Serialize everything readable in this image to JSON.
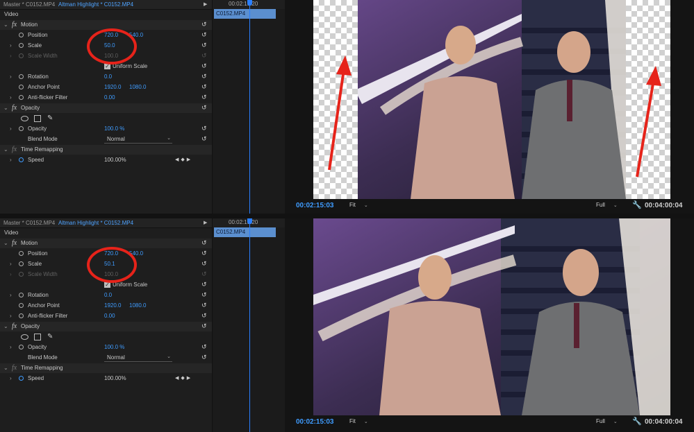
{
  "accent": "#3f9cff",
  "annotation_color": "#e6231a",
  "panels": [
    {
      "tabs": {
        "master": "Master * C0152.MP4",
        "sequence": "Altman Highlight * C0152.MP4"
      },
      "section_video": "Video",
      "motion": {
        "label": "Motion",
        "position": {
          "label": "Position",
          "x": "720.0",
          "y": "540.0"
        },
        "scale": {
          "label": "Scale",
          "value": "50.0"
        },
        "scale_width": {
          "label": "Scale Width",
          "value": "100.0"
        },
        "uniform_scale": {
          "label": "Uniform Scale",
          "checked": true
        },
        "rotation": {
          "label": "Rotation",
          "value": "0.0"
        },
        "anchor_point": {
          "label": "Anchor Point",
          "x": "1920.0",
          "y": "1080.0"
        },
        "anti_flicker": {
          "label": "Anti-flicker Filter",
          "value": "0.00"
        }
      },
      "opacity": {
        "label": "Opacity",
        "value_label": "Opacity",
        "value": "100.0 %",
        "blend_label": "Blend Mode",
        "blend_value": "Normal"
      },
      "time_remapping": {
        "label": "Time Remapping",
        "speed_label": "Speed",
        "speed_value": "100.00%"
      },
      "timeline": {
        "time": "00:02:15:20",
        "clip": "C0152.MP4"
      },
      "program": {
        "timecode": "00:02:15:03",
        "fit": "Fit",
        "quality": "Full",
        "duration": "00:04:00:04",
        "transparent_bars": true,
        "arrows": true
      }
    },
    {
      "tabs": {
        "master": "Master * C0152.MP4",
        "sequence": "Altman Highlight * C0152.MP4"
      },
      "section_video": "Video",
      "motion": {
        "label": "Motion",
        "position": {
          "label": "Position",
          "x": "720.0",
          "y": "540.0"
        },
        "scale": {
          "label": "Scale",
          "value": "50.1"
        },
        "scale_width": {
          "label": "Scale Width",
          "value": "100.0"
        },
        "uniform_scale": {
          "label": "Uniform Scale",
          "checked": true
        },
        "rotation": {
          "label": "Rotation",
          "value": "0.0"
        },
        "anchor_point": {
          "label": "Anchor Point",
          "x": "1920.0",
          "y": "1080.0"
        },
        "anti_flicker": {
          "label": "Anti-flicker Filter",
          "value": "0.00"
        }
      },
      "opacity": {
        "label": "Opacity",
        "value_label": "Opacity",
        "value": "100.0 %",
        "blend_label": "Blend Mode",
        "blend_value": "Normal"
      },
      "time_remapping": {
        "label": "Time Remapping",
        "speed_label": "Speed",
        "speed_value": "100.00%"
      },
      "timeline": {
        "time": "00:02:15:20",
        "clip": "C0152.MP4"
      },
      "program": {
        "timecode": "00:02:15:03",
        "fit": "Fit",
        "quality": "Full",
        "duration": "00:04:00:04",
        "transparent_bars": false,
        "arrows": false
      }
    }
  ]
}
